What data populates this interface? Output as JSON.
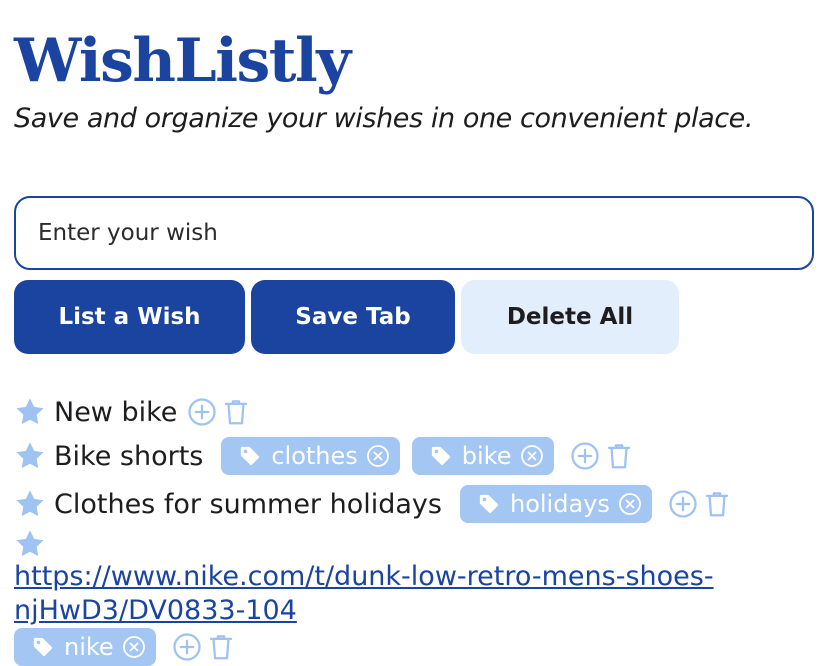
{
  "app": {
    "title": "WishListly",
    "subtitle": "Save and organize your wishes in one convenient place."
  },
  "input": {
    "placeholder": "Enter your wish"
  },
  "buttons": {
    "list_wish": "List a Wish",
    "save_tab": "Save Tab",
    "delete_all": "Delete All"
  },
  "wishes": [
    {
      "text": "New bike",
      "tags": []
    },
    {
      "text": "Bike shorts",
      "tags": [
        "clothes",
        "bike"
      ]
    },
    {
      "text": "Clothes for summer holidays",
      "tags": [
        "holidays"
      ]
    },
    {
      "text": "https://www.nike.com/t/dunk-low-retro-mens-shoes-njHwD3/DV0833-104 ",
      "is_link": true,
      "tags": [
        "nike"
      ]
    }
  ],
  "icons": {
    "star": "star-icon",
    "tag": "tag-icon",
    "remove_tag": "remove-tag-icon",
    "add_tag": "add-tag-icon",
    "delete": "trash-icon"
  },
  "colors": {
    "primary": "#1a44a0",
    "light_button": "#e3eefc",
    "tag_bg": "#a3c6f3",
    "star": "#9ec2f2",
    "icon_outline": "#9ec2f2"
  }
}
